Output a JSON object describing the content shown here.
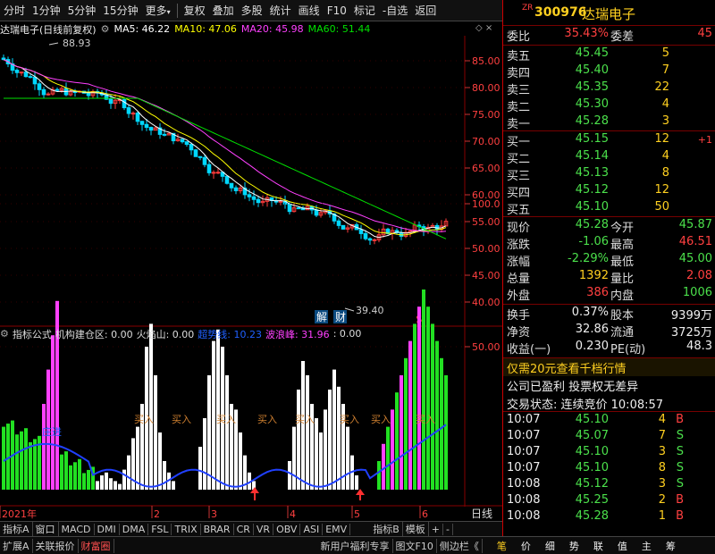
{
  "toolbar": {
    "items": [
      "分时",
      "1分钟",
      "5分钟",
      "15分钟",
      "更多",
      "复权",
      "叠加",
      "多股",
      "统计",
      "画线",
      "F10",
      "标记",
      "-自选",
      "返回"
    ]
  },
  "chart": {
    "stock_title": "达瑞电子(日线前复权)",
    "ma5": "MA5: 46.22",
    "ma10": "MA10: 47.06",
    "ma20": "MA20: 45.98",
    "ma60": "MA60: 51.44",
    "high_mark": "88.93",
    "low_mark": "39.40",
    "jie_label": "解",
    "cai_label": "财",
    "s_label": "$",
    "price_axis": [
      "85.00",
      "80.00",
      "75.00",
      "70.00",
      "65.00",
      "60.00",
      "55.00",
      "50.00",
      "45.00",
      "40.00"
    ],
    "indicator_axis": [
      "100.0",
      "50.00"
    ],
    "buy_label": "买入",
    "zhuang_label": "庄进",
    "time_axis": [
      "2021年",
      "2",
      "3",
      "4",
      "5",
      "6"
    ],
    "period": "日线",
    "colors": {
      "up": "#ff3b3b",
      "down": "#00d8ff",
      "ma5": "#ffffff",
      "ma10": "#ffff00",
      "ma20": "#ff00ff",
      "ma60": "#00e000"
    }
  },
  "indicator": {
    "label_formula": "指标公式",
    "item1": "机构建仓区: 0.00",
    "item2": "火焰山: 0.00",
    "item3": "超势线: 10.23",
    "item4": "波浪峰: 31.96",
    "item5": ": 0.00"
  },
  "quote": {
    "code_prefix": "ZR",
    "code": "300976",
    "name": "达瑞电子",
    "weibi_label": "委比",
    "weibi_value": "35.43%",
    "weicha_label": "委差",
    "weicha_value": "45",
    "sells": [
      {
        "label": "卖五",
        "price": "45.45",
        "vol": "5"
      },
      {
        "label": "卖四",
        "price": "45.40",
        "vol": "7"
      },
      {
        "label": "卖三",
        "price": "45.35",
        "vol": "22"
      },
      {
        "label": "卖二",
        "price": "45.30",
        "vol": "4"
      },
      {
        "label": "卖一",
        "price": "45.28",
        "vol": "3"
      }
    ],
    "buys": [
      {
        "label": "买一",
        "price": "45.15",
        "vol": "12",
        "chg": "+1"
      },
      {
        "label": "买二",
        "price": "45.14",
        "vol": "4",
        "chg": ""
      },
      {
        "label": "买三",
        "price": "45.13",
        "vol": "8",
        "chg": ""
      },
      {
        "label": "买四",
        "price": "45.12",
        "vol": "12",
        "chg": ""
      },
      {
        "label": "买五",
        "price": "45.10",
        "vol": "50",
        "chg": ""
      }
    ],
    "stats": [
      {
        "l1": "现价",
        "v1": "45.28",
        "l2": "今开",
        "v2": "45.87"
      },
      {
        "l1": "涨跌",
        "v1": "-1.06",
        "l2": "最高",
        "v2": "46.51"
      },
      {
        "l1": "涨幅",
        "v1": "-2.29%",
        "l2": "最低",
        "v2": "45.00"
      },
      {
        "l1": "总量",
        "v1": "1392",
        "l2": "量比",
        "v2": "2.08"
      },
      {
        "l1": "外盘",
        "v1": "386",
        "l2": "内盘",
        "v2": "1006"
      }
    ],
    "stats2": [
      {
        "l1": "换手",
        "v1": "0.37%",
        "l2": "股本",
        "v2": "9399万"
      },
      {
        "l1": "净资",
        "v1": "32.86",
        "l2": "流通",
        "v2": "3725万"
      },
      {
        "l1": "收益(一)",
        "v1": "0.230",
        "l2": "PE(动)",
        "v2": "48.3"
      }
    ],
    "promo": "仅需20元查看千档行情",
    "company_note": "公司已盈利 投票权无差异",
    "trade_state": "交易状态: 连续竞价 10:08:57",
    "ticks": [
      {
        "t": "10:07",
        "p": "45.10",
        "v": "4",
        "d": "B"
      },
      {
        "t": "10:07",
        "p": "45.07",
        "v": "7",
        "d": "S"
      },
      {
        "t": "10:07",
        "p": "45.10",
        "v": "3",
        "d": "S"
      },
      {
        "t": "10:07",
        "p": "45.10",
        "v": "8",
        "d": "S"
      },
      {
        "t": "10:08",
        "p": "45.12",
        "v": "3",
        "d": "S"
      },
      {
        "t": "10:08",
        "p": "45.25",
        "v": "2",
        "d": "B"
      },
      {
        "t": "10:08",
        "p": "45.28",
        "v": "1",
        "d": "B"
      }
    ]
  },
  "tabs_bottom1": [
    "指标A",
    "窗口",
    "MACD",
    "DMI",
    "DMA",
    "FSL",
    "TRIX",
    "BRAR",
    "CR",
    "VR",
    "OBV",
    "ASI",
    "EMV",
    "指标B",
    "模板",
    "+",
    "-"
  ],
  "tabs_bottom2": [
    "扩展A",
    "关联报价",
    "财富圈",
    "新用户福利专享",
    "图文F10",
    "侧边栏《"
  ],
  "tabs_bottom2_right": [
    "笔",
    "价",
    "细",
    "势",
    "联",
    "值",
    "主",
    "筹"
  ]
}
